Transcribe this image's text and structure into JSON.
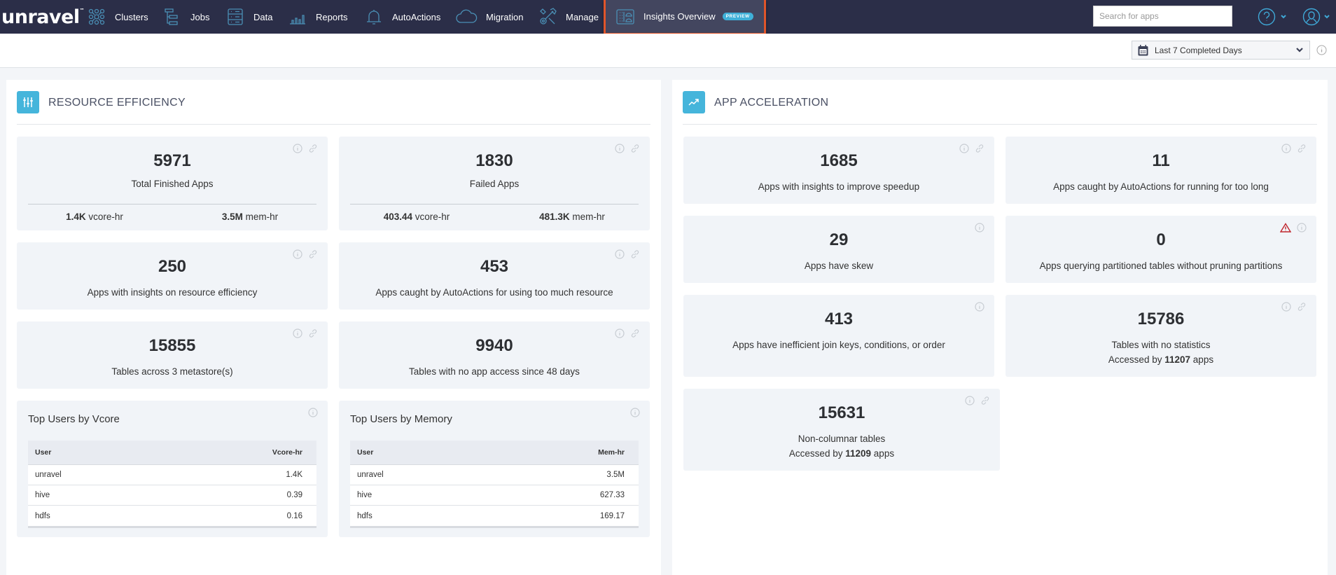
{
  "app": {
    "logo_text": "unravel",
    "logo_mark": "™"
  },
  "nav": {
    "items": [
      {
        "label": "Clusters",
        "icon": "clusters-icon"
      },
      {
        "label": "Jobs",
        "icon": "jobs-icon"
      },
      {
        "label": "Data",
        "icon": "data-icon"
      },
      {
        "label": "Reports",
        "icon": "reports-icon"
      },
      {
        "label": "AutoActions",
        "icon": "bell-icon"
      },
      {
        "label": "Migration",
        "icon": "cloud-icon"
      },
      {
        "label": "Manage",
        "icon": "wrench-gear-icon"
      },
      {
        "label": "Insights Overview",
        "icon": "dashboard-icon",
        "badge": "PREVIEW",
        "active": true
      }
    ],
    "search_placeholder": "Search for apps",
    "search_value": ""
  },
  "toolbar": {
    "date_range": "Last 7 Completed Days"
  },
  "colors": {
    "header_bg": "#2b2e48",
    "active_outline": "#e0552a",
    "accent": "#45b5db",
    "warning": "#c0262d"
  },
  "resource_efficiency": {
    "title": "RESOURCE EFFICIENCY",
    "cards": [
      {
        "value": "5971",
        "label": "Total Finished Apps",
        "vcore_value": "1.4K",
        "vcore_unit": "vcore-hr",
        "mem_value": "3.5M",
        "mem_unit": "mem-hr"
      },
      {
        "value": "1830",
        "label": "Failed Apps",
        "vcore_value": "403.44",
        "vcore_unit": "vcore-hr",
        "mem_value": "481.3K",
        "mem_unit": "mem-hr"
      },
      {
        "value": "250",
        "label": "Apps with insights on resource efficiency"
      },
      {
        "value": "453",
        "label": "Apps caught by AutoActions for using too much resource"
      },
      {
        "value": "15855",
        "label": "Tables across 3 metastore(s)"
      },
      {
        "value": "9940",
        "label": "Tables with no app access since 48 days"
      }
    ],
    "top_vcore": {
      "title": "Top Users by Vcore",
      "columns": [
        "User",
        "Vcore-hr"
      ],
      "rows": [
        {
          "user": "unravel",
          "value": "1.4K"
        },
        {
          "user": "hive",
          "value": "0.39"
        },
        {
          "user": "hdfs",
          "value": "0.16"
        }
      ]
    },
    "top_memory": {
      "title": "Top Users by Memory",
      "columns": [
        "User",
        "Mem-hr"
      ],
      "rows": [
        {
          "user": "unravel",
          "value": "3.5M"
        },
        {
          "user": "hive",
          "value": "627.33"
        },
        {
          "user": "hdfs",
          "value": "169.17"
        }
      ]
    }
  },
  "app_acceleration": {
    "title": "APP ACCELERATION",
    "cards": [
      {
        "value": "1685",
        "label": "Apps with insights to improve speedup"
      },
      {
        "value": "11",
        "label": "Apps caught by AutoActions for running for too long"
      },
      {
        "value": "29",
        "label": "Apps have skew"
      },
      {
        "value": "0",
        "label": "Apps querying partitioned tables without pruning partitions"
      },
      {
        "value": "413",
        "label": "Apps have inefficient join keys, conditions, or order"
      },
      {
        "value": "15786",
        "label": "Tables with no statistics",
        "sub_prefix": "Accessed by",
        "sub_value": "11207",
        "sub_suffix": "apps"
      },
      {
        "value": "15631",
        "label": "Non-columnar tables",
        "sub_prefix": "Accessed by",
        "sub_value": "11209",
        "sub_suffix": "apps"
      }
    ]
  }
}
